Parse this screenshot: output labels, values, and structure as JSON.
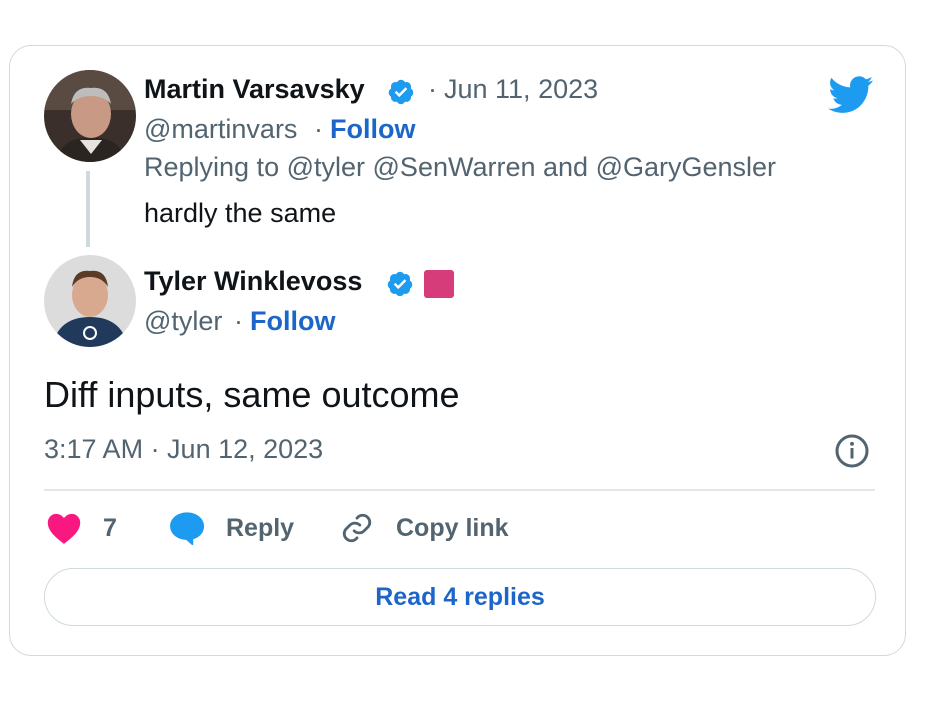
{
  "parent": {
    "author_name": "Martin Varsavsky",
    "separator": "·",
    "date": "Jun 11, 2023",
    "handle": "@martinvars",
    "follow_label": "Follow",
    "replying_label": "Replying to",
    "replying_handles": "@tyler @SenWarren",
    "replying_and": "and",
    "replying_last": "@GaryGensler",
    "text": "hardly the same"
  },
  "tweet": {
    "author_name": "Tyler Winklevoss",
    "handle": "@tyler",
    "separator": "·",
    "follow_label": "Follow",
    "text": "Diff inputs, same outcome",
    "timestamp": "3:17 AM · Jun 12, 2023"
  },
  "actions": {
    "like_count": "7",
    "reply_label": "Reply",
    "copy_label": "Copy link"
  },
  "read_replies_label": "Read 4 replies",
  "colors": {
    "follow_blue": "#1d66c9",
    "verified_blue": "#1d9bf0",
    "twitter_blue": "#1d9bf0",
    "like_pink": "#f91880",
    "badge_pink": "#d63c7a",
    "muted_text": "#536471",
    "border": "#cfd9de"
  },
  "icons": [
    "verified-badge-icon",
    "twitter-bird-icon",
    "heart-icon",
    "reply-bubble-icon",
    "link-icon",
    "info-icon",
    "affiliation-badge-icon"
  ]
}
